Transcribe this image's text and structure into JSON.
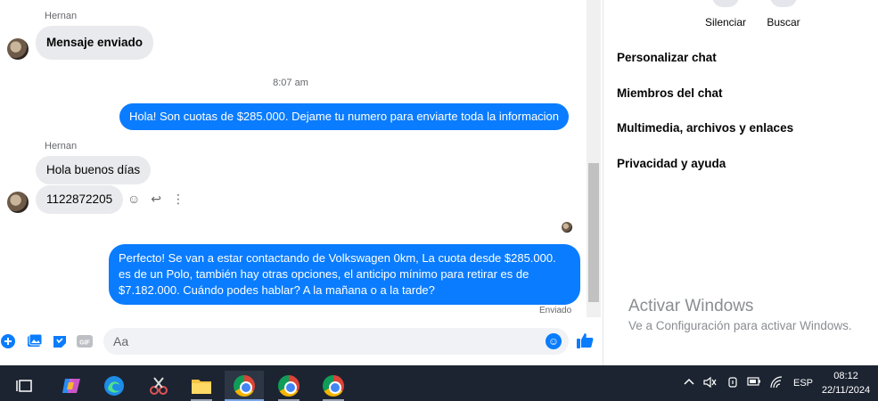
{
  "chat": {
    "messages": [
      {
        "sender": "Hernan",
        "text": "Mensaje enviado"
      },
      {
        "timestamp": "8:07 am"
      },
      {
        "text": "Hola! Son cuotas de $285.000. Dejame tu numero para enviarte toda la informacion"
      },
      {
        "sender": "Hernan",
        "text": "Hola buenos días"
      },
      {
        "text": "1122872205"
      },
      {
        "text": "Perfecto!  Se van a estar contactando de Volkswagen 0km, La cuota desde $285.000. es de un Polo, también hay otras opciones, el anticipo mínimo para retirar es de $7.182.000. Cuándo podes hablar? A la mañana o a la tarde?",
        "status": "Enviado"
      }
    ],
    "composer": {
      "placeholder": "Aa"
    }
  },
  "panel": {
    "quick_actions": [
      {
        "label": "Silenciar"
      },
      {
        "label": "Buscar"
      }
    ],
    "items": [
      {
        "label": "Personalizar chat"
      },
      {
        "label": "Miembros del chat"
      },
      {
        "label": "Multimedia, archivos y enlaces"
      },
      {
        "label": "Privacidad y ayuda"
      }
    ]
  },
  "watermark": {
    "title": "Activar Windows",
    "subtitle": "Ve a Configuración para activar Windows."
  },
  "taskbar": {
    "language": "ESP",
    "time": "08:12",
    "date": "22/11/2024"
  },
  "colors": {
    "accent": "#0a7cff",
    "taskbar": "#1c2431"
  }
}
